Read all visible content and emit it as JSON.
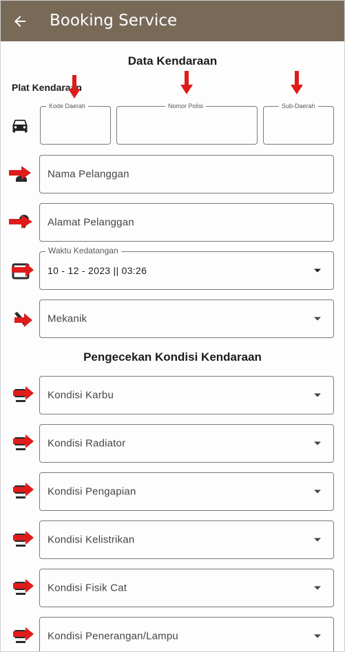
{
  "appbar": {
    "title": "Booking Service",
    "back_icon": "arrow-back-icon"
  },
  "section1": {
    "heading": "Data Kendaraan"
  },
  "plat": {
    "label": "Plat Kendaraan",
    "kode_daerah": {
      "label": "Kode Daerah",
      "value": ""
    },
    "nomor_polisi": {
      "label": "Nomor Polisi",
      "value": ""
    },
    "sub_daerah": {
      "label": "Sub-Daerah",
      "value": ""
    }
  },
  "form": {
    "nama_pelanggan": {
      "placeholder": "Nama Pelanggan",
      "icon": "person-icon"
    },
    "alamat_pelanggan": {
      "placeholder": "Alamat Pelanggan",
      "icon": "location-icon"
    },
    "waktu": {
      "label": "Waktu Kedatangan",
      "value": "10 - 12 - 2023 || 03:26",
      "icon": "calendar-icon"
    },
    "mekanik": {
      "placeholder": "Mekanik",
      "icon": "wrench-icon"
    }
  },
  "section2": {
    "heading": "Pengecekan Kondisi Kendaraan"
  },
  "kondisi": [
    {
      "label": "Kondisi Karbu"
    },
    {
      "label": "Kondisi Radiator"
    },
    {
      "label": "Kondisi Pengapian"
    },
    {
      "label": "Kondisi Kelistrikan"
    },
    {
      "label": "Kondisi Fisik Cat"
    },
    {
      "label": "Kondisi Penerangan/Lampu"
    }
  ],
  "colors": {
    "appbar": "#796a58",
    "annotation_arrow": "#e01b1b"
  }
}
